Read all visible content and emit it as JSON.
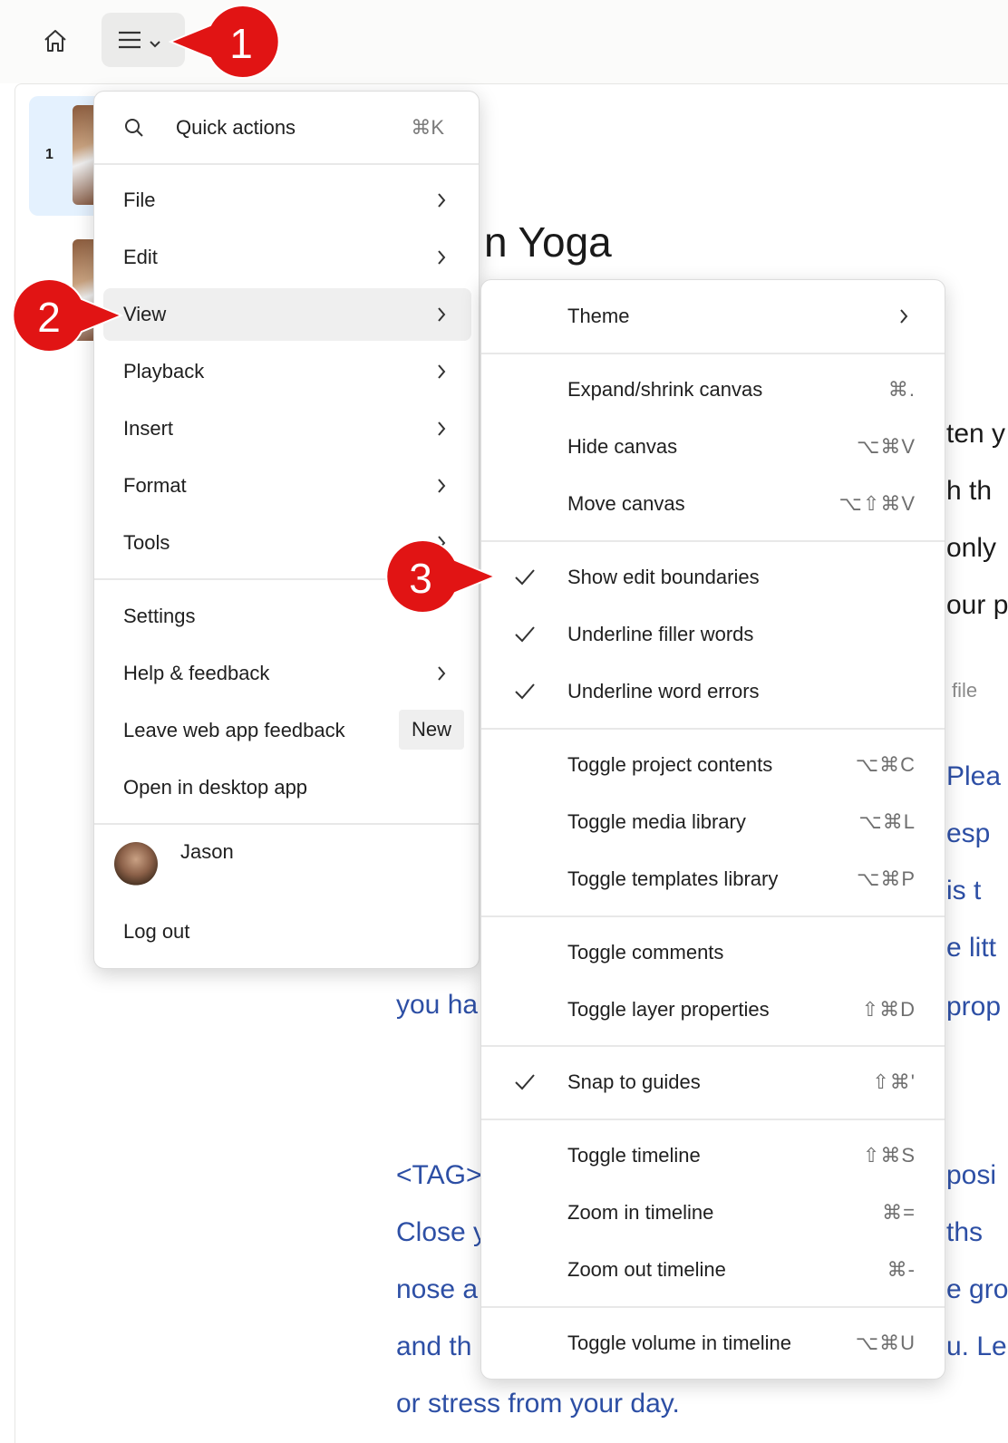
{
  "topbar": {
    "home_icon": "home-icon",
    "menu_icon": "hamburger-icon"
  },
  "scenes": {
    "active_number": "1"
  },
  "document": {
    "title_fragment": "n Yoga",
    "right_fragments": [
      "ten y",
      "h th",
      "only",
      "our p",
      "file",
      "Plea",
      "esp",
      "is t",
      "e litt",
      "prop",
      "posi",
      "ths",
      "e gro",
      "u. Le"
    ],
    "left_fragments": [
      "you ha",
      "<TAG>",
      "Close y",
      "nose a",
      "and th",
      "or stress from your day."
    ]
  },
  "main_menu": {
    "quick_actions": {
      "label": "Quick actions",
      "shortcut": "⌘K"
    },
    "items": [
      {
        "label": "File"
      },
      {
        "label": "Edit"
      },
      {
        "label": "View"
      },
      {
        "label": "Playback"
      },
      {
        "label": "Insert"
      },
      {
        "label": "Format"
      },
      {
        "label": "Tools"
      }
    ],
    "settings": "Settings",
    "help": "Help & feedback",
    "feedback": "Leave web app feedback",
    "new_badge": "New",
    "desktop": "Open in desktop app",
    "user_name": "Jason",
    "logout": "Log out"
  },
  "view_submenu": {
    "theme": "Theme",
    "items": [
      {
        "label": "Expand/shrink canvas",
        "shortcut": "⌘."
      },
      {
        "label": "Hide canvas",
        "shortcut": "⌥⌘V"
      },
      {
        "label": "Move canvas",
        "shortcut": "⌥⇧⌘V"
      },
      {
        "label": "Show edit boundaries",
        "shortcut": ""
      },
      {
        "label": "Underline filler words",
        "shortcut": ""
      },
      {
        "label": "Underline word errors",
        "shortcut": ""
      },
      {
        "label": "Toggle project contents",
        "shortcut": "⌥⌘C"
      },
      {
        "label": "Toggle media library",
        "shortcut": "⌥⌘L"
      },
      {
        "label": "Toggle templates library",
        "shortcut": "⌥⌘P"
      },
      {
        "label": "Toggle comments",
        "shortcut": ""
      },
      {
        "label": "Toggle layer properties",
        "shortcut": "⇧⌘D"
      },
      {
        "label": "Snap to guides",
        "shortcut": "⇧⌘'"
      },
      {
        "label": "Toggle timeline",
        "shortcut": "⇧⌘S"
      },
      {
        "label": "Zoom in timeline",
        "shortcut": "⌘="
      },
      {
        "label": "Zoom out timeline",
        "shortcut": "⌘-"
      },
      {
        "label": "Toggle volume in timeline",
        "shortcut": "⌥⌘U"
      }
    ]
  },
  "annotations": {
    "step1": "1",
    "step2": "2",
    "step3": "3",
    "color": "#e11414"
  }
}
